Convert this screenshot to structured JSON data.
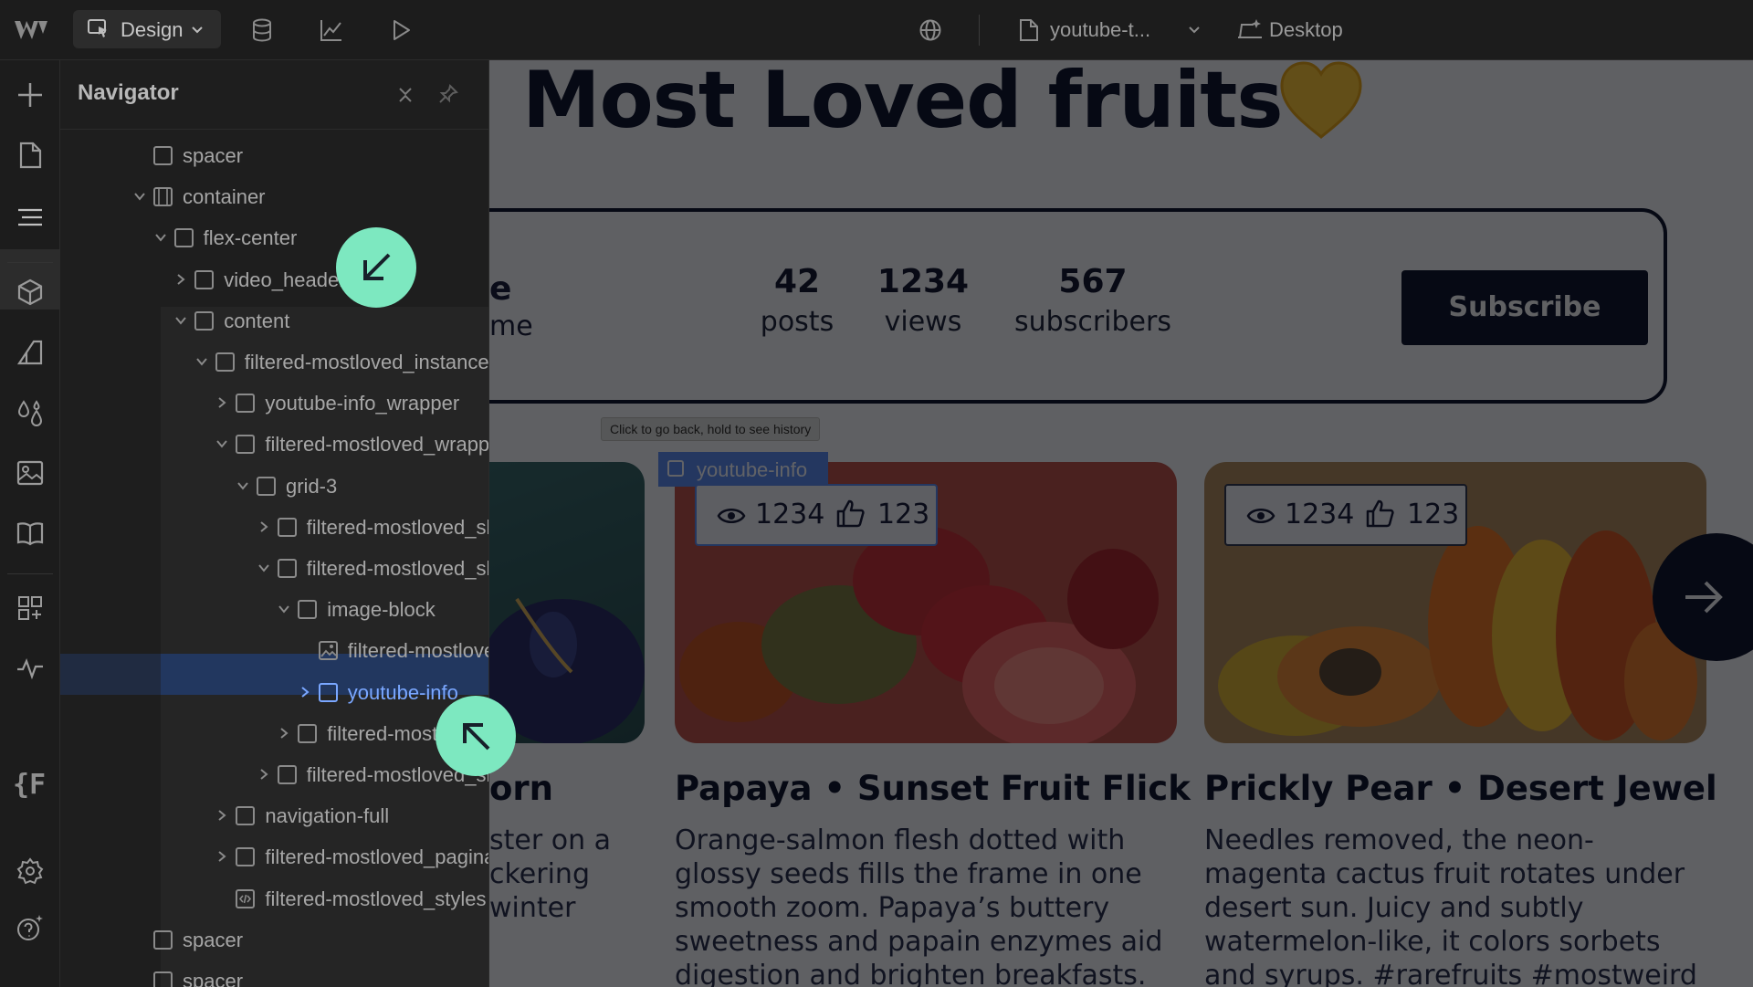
{
  "topbar": {
    "mode_label": "Design",
    "page_name": "youtube-t...",
    "breakpoint_label": "Desktop"
  },
  "navigator": {
    "title": "Navigator",
    "tree": [
      {
        "label": "spacer",
        "type": "box",
        "indent": 0,
        "expand": "none"
      },
      {
        "label": "container",
        "type": "container",
        "indent": 0,
        "expand": "open"
      },
      {
        "label": "flex-center",
        "type": "box",
        "indent": 1,
        "expand": "open"
      },
      {
        "label": "video_header",
        "type": "box",
        "indent": 2,
        "expand": "closed"
      },
      {
        "label": "content",
        "type": "box",
        "indent": 2,
        "expand": "open"
      },
      {
        "label": "filtered-mostloved_instance",
        "type": "box",
        "indent": 3,
        "expand": "open"
      },
      {
        "label": "youtube-info_wrapper",
        "type": "box",
        "indent": 4,
        "expand": "closed"
      },
      {
        "label": "filtered-mostloved_wrapper",
        "type": "box",
        "indent": 4,
        "expand": "open"
      },
      {
        "label": "grid-3",
        "type": "box",
        "indent": 5,
        "expand": "open"
      },
      {
        "label": "filtered-mostloved_slide",
        "type": "box",
        "indent": 6,
        "expand": "closed"
      },
      {
        "label": "filtered-mostloved_slide",
        "type": "box",
        "indent": 6,
        "expand": "open"
      },
      {
        "label": "image-block",
        "type": "box",
        "indent": 7,
        "expand": "open"
      },
      {
        "label": "filtered-mostloved_image",
        "type": "image",
        "indent": 8,
        "expand": "none"
      },
      {
        "label": "youtube-info",
        "type": "box",
        "indent": 8,
        "expand": "closed",
        "selected": true
      },
      {
        "label": "filtered-mostloved_text",
        "type": "box",
        "indent": 7,
        "expand": "closed"
      },
      {
        "label": "filtered-mostloved_slide",
        "type": "box",
        "indent": 6,
        "expand": "closed"
      },
      {
        "label": "navigation-full",
        "type": "box",
        "indent": 4,
        "expand": "closed"
      },
      {
        "label": "filtered-mostloved_pagination",
        "type": "box",
        "indent": 4,
        "expand": "closed"
      },
      {
        "label": "filtered-mostloved_styles",
        "type": "code",
        "indent": 4,
        "expand": "none"
      },
      {
        "label": "spacer",
        "type": "box",
        "indent": 0,
        "expand": "none"
      },
      {
        "label": "spacer",
        "type": "box",
        "indent": 0,
        "expand": "none"
      }
    ]
  },
  "canvas": {
    "heading": "Most Loved fruits",
    "channel": {
      "name_partial": "me",
      "name_partial_top": "e"
    },
    "stats": [
      {
        "value": "42",
        "label": "posts"
      },
      {
        "value": "1234",
        "label": "views"
      },
      {
        "value": "567",
        "label": "subscribers"
      }
    ],
    "subscribe_label": "Subscribe",
    "tooltip": "Click to go back, hold to see history",
    "selected_tag": "youtube-info",
    "cards": [
      {
        "title": "orn",
        "description": [
          "ster on a",
          "ckering",
          "winter"
        ]
      },
      {
        "title": "Papaya • Sunset Fruit Flick",
        "views": "1234",
        "likes": "123",
        "description": [
          "Orange-salmon flesh dotted with",
          "glossy seeds fills the frame in one",
          "smooth zoom. Papaya’s buttery",
          "sweetness and papain enzymes aid",
          "digestion and brighten breakfasts."
        ]
      },
      {
        "title": "Prickly Pear • Desert Jewel",
        "views": "1234",
        "likes": "123",
        "description": [
          "Needles removed, the neon-",
          "magenta cactus fruit rotates under",
          "desert sun. Juicy and subtly",
          "watermelon-like, it colors sorbets",
          "and syrups. #rarefruits #mostweird"
        ]
      }
    ]
  },
  "colors": {
    "accent": "#7de8c0",
    "selection": "#22375f",
    "selected_text": "#7aa7ff",
    "brand_dark": "#111833"
  }
}
